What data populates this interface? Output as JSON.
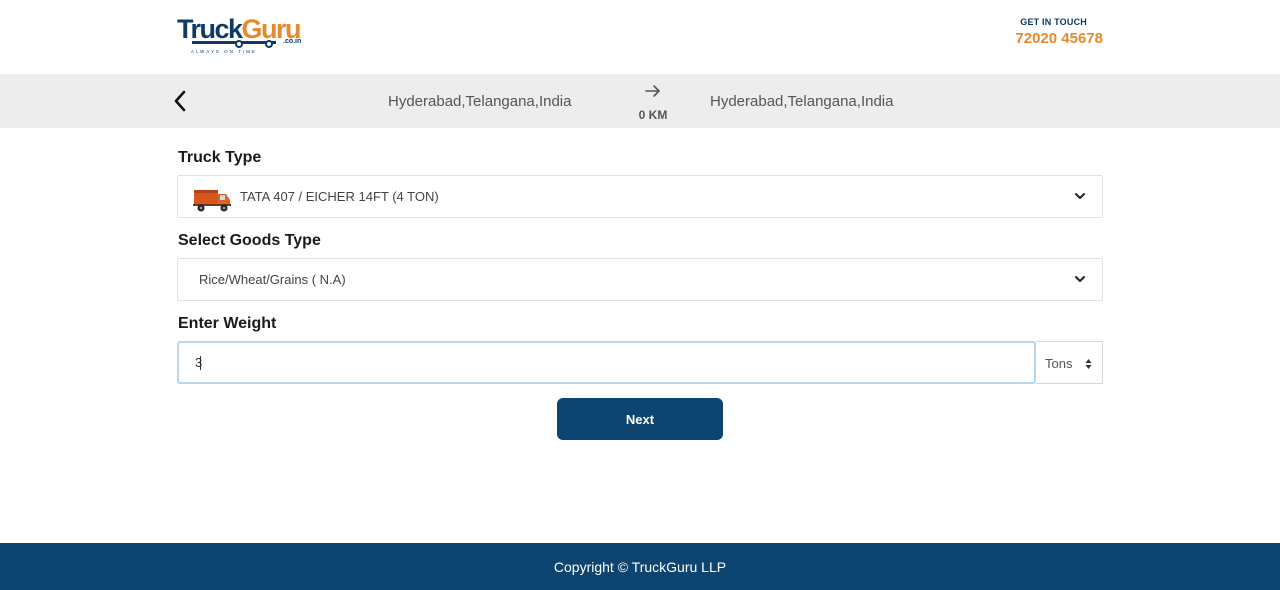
{
  "header": {
    "logo": {
      "word_part1": "Truck",
      "word_part2": "Guru",
      "domain_suffix": ".co.in",
      "tagline": "ALWAYS ON TIME"
    },
    "contact_label": "GET IN TOUCH",
    "contact_phone": "72020 45678"
  },
  "route": {
    "back_icon": "chevron-left-icon",
    "from": "Hyderabad,Telangana,India",
    "arrow_icon": "arrow-right-icon",
    "distance": "0 KM",
    "to": "Hyderabad,Telangana,India"
  },
  "form": {
    "truck_type_label": "Truck Type",
    "truck_type_value": "TATA 407 / EICHER 14FT (4 TON)",
    "goods_type_label": "Select Goods Type",
    "goods_type_value": "Rice/Wheat/Grains ( N.A)",
    "weight_label": "Enter Weight",
    "weight_value": "3",
    "unit_value": "Tons",
    "next_label": "Next"
  },
  "footer": {
    "copyright": "Copyright © TruckGuru LLP"
  },
  "colors": {
    "brand_navy": "#0d4470",
    "brand_orange": "#e8892b",
    "route_bar_bg": "#ededed"
  }
}
